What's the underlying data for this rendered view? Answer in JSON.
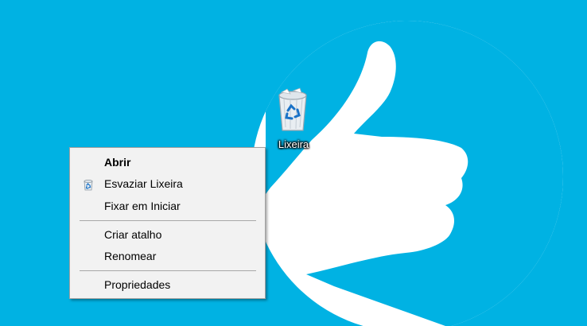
{
  "desktop": {
    "background_color": "#00b2e3",
    "wallpaper_shape_color": "#ffffff",
    "wallpaper_motif": "thumbs-up",
    "icon": {
      "label": "Lixeira",
      "icon": "recycle-bin-icon"
    }
  },
  "context_menu": {
    "items": [
      {
        "label": "Abrir",
        "default": true
      },
      {
        "label": "Esvaziar Lixeira",
        "icon": "recycle-bin-icon"
      },
      {
        "label": "Fixar em Iniciar"
      },
      {
        "label": "Criar atalho"
      },
      {
        "label": "Renomear"
      },
      {
        "label": "Propriedades"
      }
    ]
  }
}
